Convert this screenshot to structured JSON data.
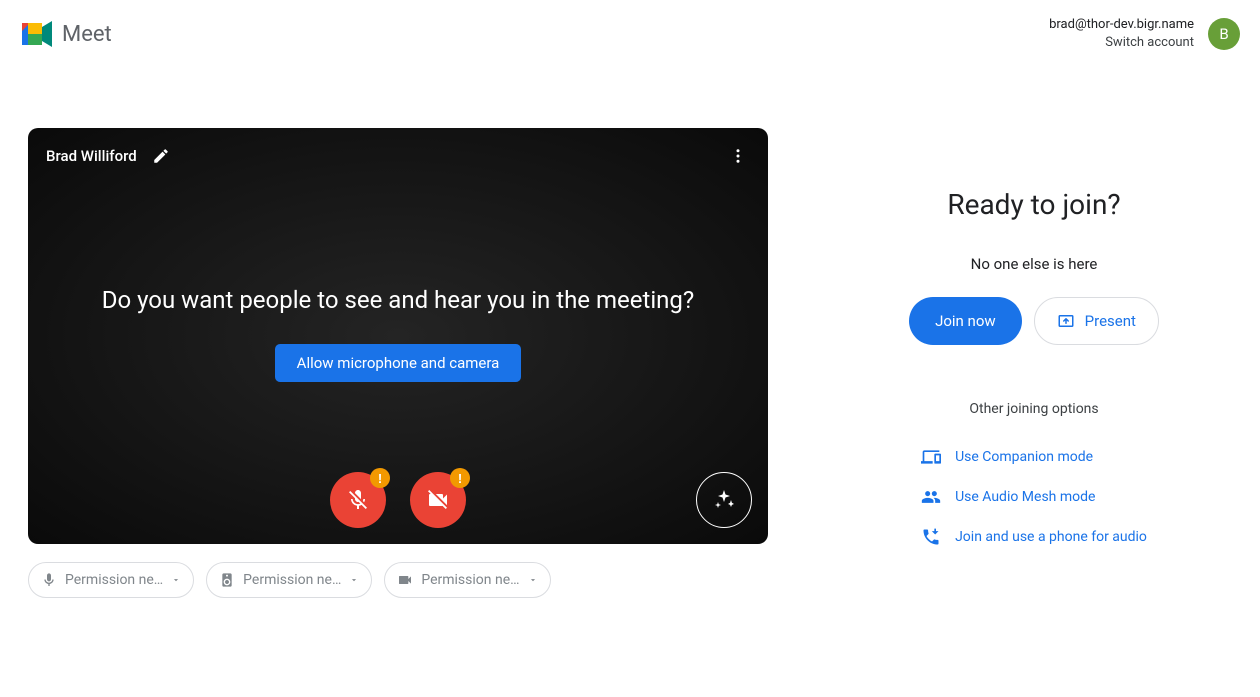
{
  "header": {
    "product_name": "Meet",
    "account_email": "brad@thor-dev.bigr.name",
    "switch_account": "Switch account",
    "avatar_letter": "B"
  },
  "preview": {
    "participant_name": "Brad Williford",
    "headline": "Do you want people to see and hear you in the meeting?",
    "allow_button": "Allow microphone and camera"
  },
  "devices": {
    "mic_label": "Permission ne…",
    "speaker_label": "Permission ne…",
    "camera_label": "Permission ne…"
  },
  "join": {
    "heading": "Ready to join?",
    "sub": "No one else is here",
    "join_now": "Join now",
    "present": "Present",
    "other_title": "Other joining options",
    "companion": "Use Companion mode",
    "audio_mesh": "Use Audio Mesh mode",
    "phone": "Join and use a phone for audio"
  }
}
